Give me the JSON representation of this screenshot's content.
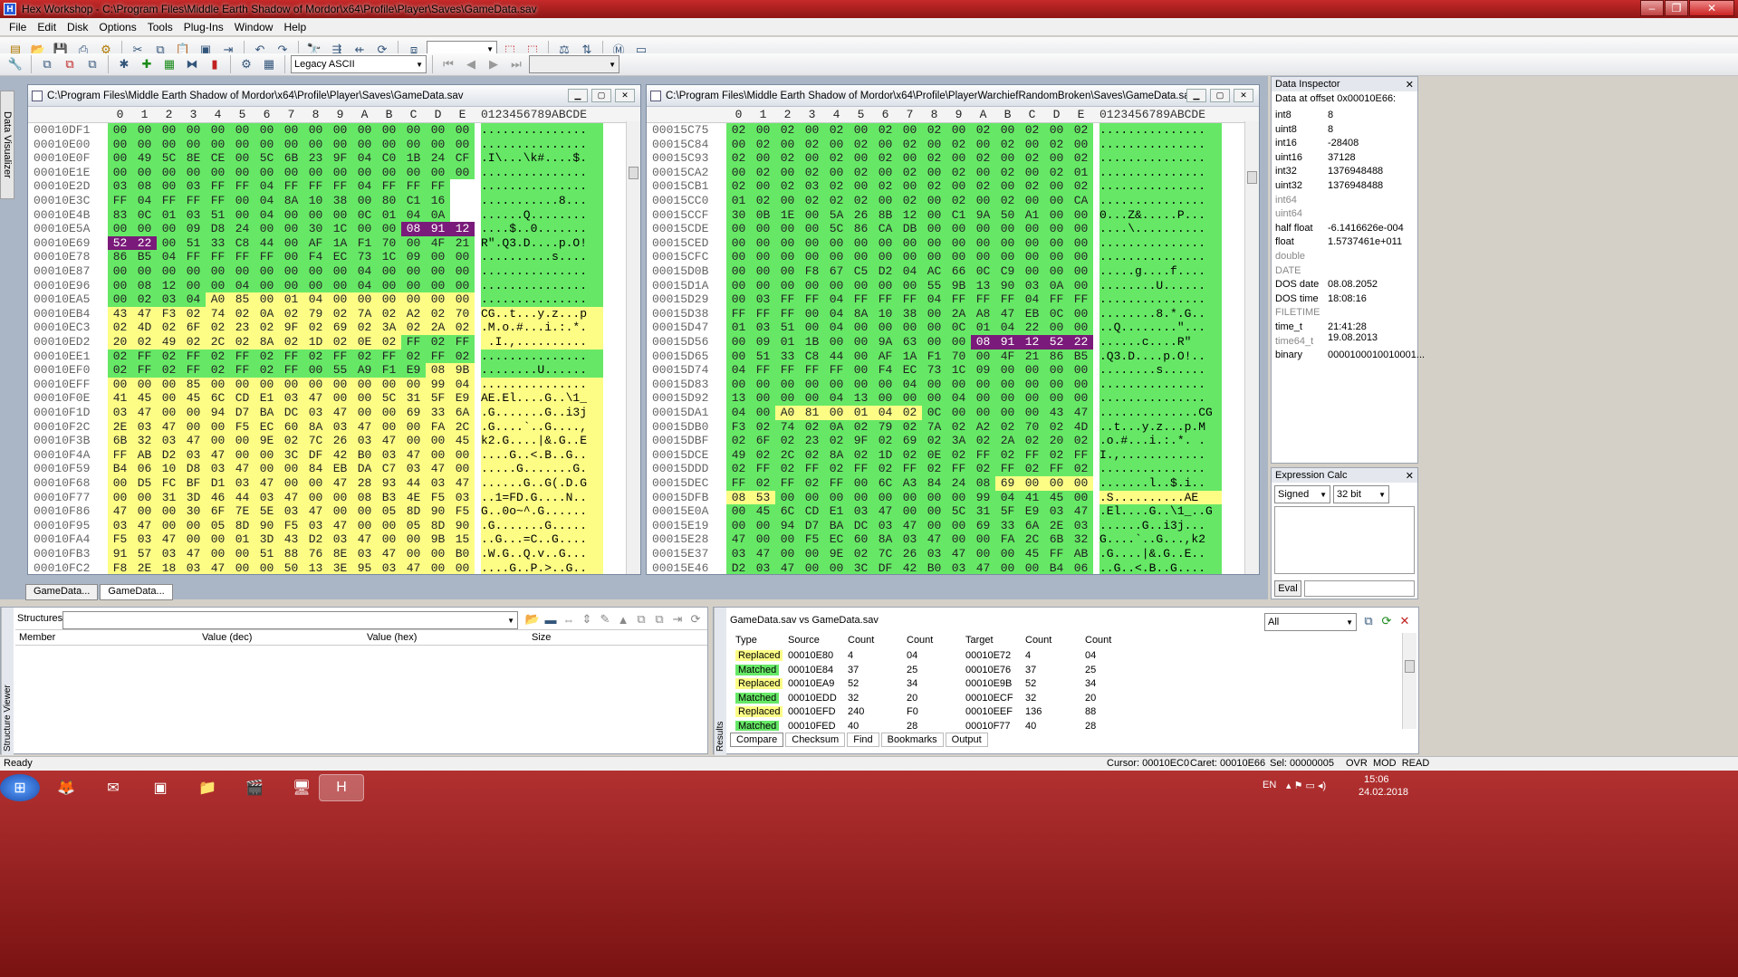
{
  "window": {
    "title": "Hex Workshop - C:\\Program Files\\Middle Earth Shadow of Mordor\\x64\\Profile\\Player\\Saves\\GameData.sav"
  },
  "menu": [
    "File",
    "Edit",
    "Disk",
    "Options",
    "Tools",
    "Plug-Ins",
    "Window",
    "Help"
  ],
  "toolbar": {
    "encoding": "Legacy ASCII"
  },
  "side_tabs": {
    "left": "Data Visualizer",
    "structure": "Structure Viewer",
    "results": "Results"
  },
  "left_hex": {
    "title": "C:\\Program Files\\Middle Earth Shadow of Mordor\\x64\\Profile\\Player\\Saves\\GameData.sav",
    "columns": [
      "0",
      "1",
      "2",
      "3",
      "4",
      "5",
      "6",
      "7",
      "8",
      "9",
      "A",
      "B",
      "C",
      "D",
      "E"
    ],
    "ascii_header": "0123456789ABCDE",
    "rows": [
      [
        "00010DF1",
        "00 00 00 00 00 00 00 00 00 00 00 00 00 00 00",
        "...............",
        "ggggggggggggggg"
      ],
      [
        "00010E00",
        "00 00 00 00 00 00 00 00 00 00 00 00 00 00 00",
        "...............",
        "ggggggggggggggg"
      ],
      [
        "00010E0F",
        "00 49 5C 8E CE 00 5C 6B 23 9F 04 C0 1B 24 CF",
        ".I\\...\\k#....$.",
        "ggggggggggggggg"
      ],
      [
        "00010E1E",
        "00 00 00 00 00 00 00 00 00 00 00 00 00 00 00",
        "...............",
        "ggggggggggggggg"
      ],
      [
        "00010E2D",
        "03 08 00 03 FF FF 04 FF FF FF 04 FF FF FF",
        "...............",
        "ggggggggggggggg"
      ],
      [
        "00010E3C",
        "FF 04 FF FF FF 00 04 8A 10 38 00 80 C1 16",
        "...........8...",
        "ggggggggggggggg"
      ],
      [
        "00010E4B",
        "83 0C 01 03 51 00 04 00 00 00 0C 01 04 0A",
        "......Q........",
        "ggggggggggggggg"
      ],
      [
        "00010E5A",
        "00 00 00 09 D8 24 00 00 30 1C 00 00 08 91 12",
        "....$..0.......",
        "ggggggggggggppp"
      ],
      [
        "00010E69",
        "52 22 00 51 33 C8 44 00 AF 1A F1 70 00 4F 21",
        "R\".Q3.D....p.O!",
        "ppggggggggggggg"
      ],
      [
        "00010E78",
        "86 B5 04 FF FF FF FF 00 F4 EC 73 1C 09 00 00",
        "..........s....",
        "ggggggggggggggg"
      ],
      [
        "00010E87",
        "00 00 00 00 00 00 00 00 00 00 04 00 00 00 00",
        "...............",
        "ggggggggggggggg"
      ],
      [
        "00010E96",
        "00 08 12 00 00 04 00 00 00 00 04 00 00 00 00",
        "...............",
        "ggggggggggggggg"
      ],
      [
        "00010EA5",
        "00 02 03 04 A0 85 00 01 04 00 00 00 00 00 00",
        "...............",
        "ggggyyyyyyyyyyy"
      ],
      [
        "00010EB4",
        "43 47 F3 02 74 02 0A 02 79 02 7A 02 A2 02 70",
        "CG..t...y.z...p",
        "yyyyyyyyyyyyyyy"
      ],
      [
        "00010EC3",
        "02 4D 02 6F 02 23 02 9F 02 69 02 3A 02 2A 02",
        ".M.o.#...i.:.*.",
        "yyyyyyyyyyyyyyy"
      ],
      [
        "00010ED2",
        "20 02 49 02 2C 02 8A 02 1D 02 0E 02 FF 02 FF",
        " .I.,..........",
        "yyyyyyyyyyyyggg"
      ],
      [
        "00010EE1",
        "02 FF 02 FF 02 FF 02 FF 02 FF 02 FF 02 FF 02",
        "...............",
        "ggggggggggggggg"
      ],
      [
        "00010EF0",
        "02 FF 02 FF 02 FF 02 FF 00 55 A9 F1 E9 08 9B 00",
        "........U......",
        "gggggggggggggyy"
      ],
      [
        "00010EFF",
        "00 00 00 85 00 00 00 00 00 00 00 00 00 99 04",
        "...............",
        "yyyyyyyyyyyyyyy"
      ],
      [
        "00010F0E",
        "41 45 00 45 6C CD E1 03 47 00 00 5C 31 5F E9",
        "AE.El....G..\\1_",
        "yyyyyyyyyyyyyyy"
      ],
      [
        "00010F1D",
        "03 47 00 00 94 D7 BA DC 03 47 00 00 69 33 6A",
        ".G.......G..i3j",
        "yyyyyyyyyyyyyyy"
      ],
      [
        "00010F2C",
        "2E 03 47 00 00 F5 EC 60 8A 03 47 00 00 FA 2C",
        ".G....`..G....,",
        "yyyyyyyyyyyyyyy"
      ],
      [
        "00010F3B",
        "6B 32 03 47 00 00 9E 02 7C 26 03 47 00 00 45",
        "k2.G....|&.G..E",
        "yyyyyyyyyyyyyyy"
      ],
      [
        "00010F4A",
        "FF AB D2 03 47 00 00 3C DF 42 B0 03 47 00 00",
        "....G..<.B..G..",
        "yyyyyyyyyyyyyyy"
      ],
      [
        "00010F59",
        "B4 06 10 D8 03 47 00 00 84 EB DA C7 03 47 00",
        ".....G.......G.",
        "yyyyyyyyyyyyyyy"
      ],
      [
        "00010F68",
        "00 D5 FC BF D1 03 47 00 00 47 28 93 44 03 47",
        "......G..G(.D.G",
        "yyyyyyyyyyyyyyy"
      ],
      [
        "00010F77",
        "00 00 31 3D 46 44 03 47 00 00 08 B3 4E F5 03",
        "..1=FD.G....N..",
        "yyyyyyyyyyyyyyy"
      ],
      [
        "00010F86",
        "47 00 00 30 6F 7E 5E 03 47 00 00 05 8D 90 F5",
        "G..0o~^.G......",
        "yyyyyyyyyyyyyyy"
      ],
      [
        "00010F95",
        "03 47 00 00 05 8D 90 F5 03 47 00 00 05 8D 90",
        ".G.......G.....",
        "yyyyyyyyyyyyyyy"
      ],
      [
        "00010FA4",
        "F5 03 47 00 00 01 3D 43 D2 03 47 00 00 9B 15",
        "..G...=C..G....",
        "yyyyyyyyyyyyyyy"
      ],
      [
        "00010FB3",
        "91 57 03 47 00 00 51 88 76 8E 03 47 00 00 B0",
        ".W.G..Q.v..G...",
        "yyyyyyyyyyyyyyy"
      ],
      [
        "00010FC2",
        "F8 2E 18 03 47 00 00 50 13 3E 95 03 47 00 00",
        "....G..P.>..G..",
        "yyyyyyyyyyyyyyy"
      ]
    ]
  },
  "right_hex": {
    "title": "C:\\Program Files\\Middle Earth Shadow of Mordor\\x64\\Profile\\PlayerWarchiefRandomBroken\\Saves\\GameData.sav",
    "columns": [
      "0",
      "1",
      "2",
      "3",
      "4",
      "5",
      "6",
      "7",
      "8",
      "9",
      "A",
      "B",
      "C",
      "D",
      "E"
    ],
    "ascii_header": "0123456789ABCDE",
    "rows": [
      [
        "00015C75",
        "02 00 02 00 02 00 02 00 02 00 02 00 02 00 02",
        "...............",
        "ggggggggggggggg"
      ],
      [
        "00015C84",
        "00 02 00 02 00 02 00 02 00 02 00 02 00 02 00",
        "...............",
        "ggggggggggggggg"
      ],
      [
        "00015C93",
        "02 00 02 00 02 00 02 00 02 00 02 00 02 00 02",
        "...............",
        "ggggggggggggggg"
      ],
      [
        "00015CA2",
        "00 02 00 02 00 02 00 02 00 02 00 02 00 02 01",
        "...............",
        "ggggggggggggggg"
      ],
      [
        "00015CB1",
        "02 00 02 03 02 00 02 00 02 00 02 00 02 00 02",
        "...............",
        "ggggggggggggggg"
      ],
      [
        "00015CC0",
        "01 02 00 02 02 02 00 02 00 02 00 02 00 00 CA",
        "...............",
        "ggggggggggggggg"
      ],
      [
        "00015CCF",
        "30 0B 1E 00 5A 26 8B 12 00 C1 9A 50 A1 00 00",
        "0...Z&.....P...",
        "ggggggggggggggg"
      ],
      [
        "00015CDE",
        "00 00 00 00 5C 86 CA DB 00 00 00 00 00 00 00",
        "....\\..........",
        "ggggggggggggggg"
      ],
      [
        "00015CED",
        "00 00 00 00 00 00 00 00 00 00 00 00 00 00 00",
        "...............",
        "ggggggggggggggg"
      ],
      [
        "00015CFC",
        "00 00 00 00 00 00 00 00 00 00 00 00 00 00 00",
        "...............",
        "ggggggggggggggg"
      ],
      [
        "00015D0B",
        "00 00 00 F8 67 C5 D2 04 AC 66 0C C9 00 00 00",
        ".....g....f....",
        "ggggggggggggggg"
      ],
      [
        "00015D1A",
        "00 00 00 00 00 00 00 00 55 9B 13 90 03 0A 00",
        "........U......",
        "ggggggggggggggg"
      ],
      [
        "00015D29",
        "00 03 FF FF 04 FF FF FF 04 FF FF FF 04 FF FF",
        "...............",
        "ggggggggggggggg"
      ],
      [
        "00015D38",
        "FF FF FF 00 04 8A 10 38 00 2A A8 47 EB 0C 00",
        "........8.*.G..",
        "ggggggggggggggg"
      ],
      [
        "00015D47",
        "01 03 51 00 04 00 00 00 00 0C 01 04 22 00 00",
        "..Q........\"...",
        "ggggggggggggggg"
      ],
      [
        "00015D56",
        "00 09 01 1B 00 00 9A 63 00 00 08 91 12 52 22",
        "......c....R\"",
        "ggggggggggppppp"
      ],
      [
        "00015D65",
        "00 51 33 C8 44 00 AF 1A F1 70 00 4F 21 86 B5",
        ".Q3.D....p.O!..",
        "ggggggggggggggg"
      ],
      [
        "00015D74",
        "04 FF FF FF FF 00 F4 EC 73 1C 09 00 00 00 00",
        "........s......",
        "ggggggggggggggg"
      ],
      [
        "00015D83",
        "00 00 00 00 00 00 00 04 00 00 00 00 00 00 00",
        "...............",
        "ggggggggggggggg"
      ],
      [
        "00015D92",
        "13 00 00 00 04 13 00 00 00 04 00 00 00 00 00",
        "...............",
        "ggggggggggggggg"
      ],
      [
        "00015DA1",
        "04 00 A0 81 00 01 04 02 0C 00 00 00 00 43 47",
        "..............CG",
        "ggyyyyyyggggggg"
      ],
      [
        "00015DB0",
        "F3 02 74 02 0A 02 79 02 7A 02 A2 02 70 02 4D",
        "..t...y.z...p.M",
        "ggggggggggggggg"
      ],
      [
        "00015DBF",
        "02 6F 02 23 02 9F 02 69 02 3A 02 2A 02 20 02",
        ".o.#...i.:.*. .",
        "ggggggggggggggg"
      ],
      [
        "00015DCE",
        "49 02 2C 02 8A 02 1D 02 0E 02 FF 02 FF 02 FF",
        "I.,............",
        "ggggggggggggggg"
      ],
      [
        "00015DDD",
        "02 FF 02 FF 02 FF 02 FF 02 FF 02 FF 02 FF 02",
        "...............",
        "ggggggggggggggg"
      ],
      [
        "00015DEC",
        "FF 02 FF 02 FF 00 6C A3 84 24 08 69 00 00 00",
        ".......l..$.i..",
        "gggggggggggyyyy"
      ],
      [
        "00015DFB",
        "08 53 00 00 00 00 00 00 00 00 99 04 41 45 00",
        ".S..........AE",
        "yyggggggggggggg"
      ],
      [
        "00015E0A",
        "00 45 6C CD E1 03 47 00 00 5C 31 5F E9 03 47",
        ".El....G..\\1_..G",
        "ggggggggggggggg"
      ],
      [
        "00015E19",
        "00 00 94 D7 BA DC 03 47 00 00 69 33 6A 2E 03",
        "......G..i3j...",
        "ggggggggggggggg"
      ],
      [
        "00015E28",
        "47 00 00 F5 EC 60 8A 03 47 00 00 FA 2C 6B 32",
        "G....`..G...,k2",
        "ggggggggggggggg"
      ],
      [
        "00015E37",
        "03 47 00 00 9E 02 7C 26 03 47 00 00 45 FF AB",
        ".G....|&.G..E..",
        "ggggggggggggggg"
      ],
      [
        "00015E46",
        "D2 03 47 00 00 3C DF 42 B0 03 47 00 00 B4 06",
        "..G..<.B..G....",
        "ggggggggggggggg"
      ]
    ]
  },
  "doc_tabs": [
    "GameData...",
    "GameData..."
  ],
  "data_inspector": {
    "title": "Data Inspector",
    "offset": "Data at offset 0x00010E66:",
    "rows": [
      [
        "int8",
        "8",
        false
      ],
      [
        "uint8",
        "8",
        false
      ],
      [
        "int16",
        "-28408",
        false
      ],
      [
        "uint16",
        "37128",
        false
      ],
      [
        "int32",
        "1376948488",
        false
      ],
      [
        "uint32",
        "1376948488",
        false
      ],
      [
        "int64",
        "",
        true
      ],
      [
        "uint64",
        "",
        true
      ],
      [
        "half float",
        "-6.1416626e-004",
        false
      ],
      [
        "float",
        "1.5737461e+011",
        false
      ],
      [
        "double",
        "",
        true
      ],
      [
        "DATE",
        "",
        true
      ],
      [
        "DOS date",
        "08.08.2052",
        false
      ],
      [
        "DOS time",
        "18:08:16",
        false
      ],
      [
        "FILETIME",
        "",
        true
      ],
      [
        "time_t",
        "21:41:28 19.08.2013",
        false
      ],
      [
        "time64_t",
        "",
        true
      ],
      [
        "binary",
        "0000100010010001...",
        false
      ]
    ]
  },
  "expression_calc": {
    "title": "Expression Calc",
    "sign": "Signed",
    "bits": "32 bit",
    "eval_label": "Eval"
  },
  "structures": {
    "label": "Structures",
    "headers": [
      "Member",
      "Value (dec)",
      "Value (hex)",
      "Size"
    ]
  },
  "compare": {
    "title": "GameData.sav vs GameData.sav",
    "filter": "All",
    "headers": [
      "Type",
      "Source",
      "Count",
      "Count",
      "Target",
      "Count",
      "Count"
    ],
    "rows": [
      [
        "Replaced",
        "00010E80",
        "4",
        "04",
        "00010E72",
        "4",
        "04"
      ],
      [
        "Matched",
        "00010E84",
        "37",
        "25",
        "00010E76",
        "37",
        "25"
      ],
      [
        "Replaced",
        "00010EA9",
        "52",
        "34",
        "00010E9B",
        "52",
        "34"
      ],
      [
        "Matched",
        "00010EDD",
        "32",
        "20",
        "00010ECF",
        "32",
        "20"
      ],
      [
        "Replaced",
        "00010EFD",
        "240",
        "F0",
        "00010EEF",
        "136",
        "88"
      ],
      [
        "Matched",
        "00010FED",
        "40",
        "28",
        "00010F77",
        "40",
        "28"
      ]
    ],
    "tabs": [
      "Compare",
      "Checksum",
      "Find",
      "Bookmarks",
      "Output"
    ]
  },
  "status": {
    "left": "Ready",
    "cursor": "Cursor: 00010EC0",
    "caret": "Caret: 00010E66",
    "sel": "Sel: 00000005",
    "modes": "OVR  MOD  READ"
  },
  "tray": {
    "lang": "EN",
    "time": "15:06",
    "date": "24.02.2018"
  }
}
